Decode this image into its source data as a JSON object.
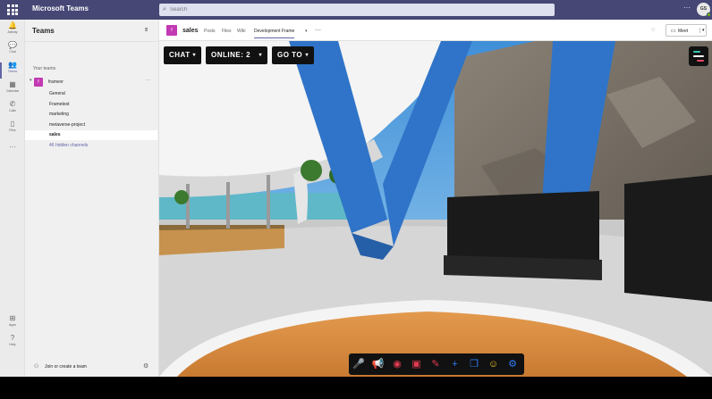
{
  "app": {
    "title": "Microsoft Teams"
  },
  "search": {
    "placeholder": "Search"
  },
  "user": {
    "initials": "GS"
  },
  "rail": [
    {
      "label": "Activity",
      "icon": "bell-icon",
      "glyph": "🔔"
    },
    {
      "label": "Chat",
      "icon": "chat-icon",
      "glyph": "💬"
    },
    {
      "label": "Teams",
      "icon": "teams-icon",
      "glyph": "👥"
    },
    {
      "label": "Calendar",
      "icon": "calendar-icon",
      "glyph": "▦"
    },
    {
      "label": "Calls",
      "icon": "phone-icon",
      "glyph": "✆"
    },
    {
      "label": "Files",
      "icon": "file-icon",
      "glyph": "▯"
    },
    {
      "label": "",
      "icon": "more-icon",
      "glyph": "···"
    },
    {
      "label": "Apps",
      "icon": "apps-icon",
      "glyph": "⊞"
    },
    {
      "label": "Help",
      "icon": "help-icon",
      "glyph": "?"
    }
  ],
  "sidebar": {
    "title": "Teams",
    "your_teams": "Your teams",
    "team": {
      "initial": "f",
      "name": "framevr"
    },
    "channels": [
      {
        "name": "General",
        "selected": false
      },
      {
        "name": "Frametest",
        "selected": false
      },
      {
        "name": "marketing",
        "selected": false
      },
      {
        "name": "metaverse-project",
        "selected": false
      },
      {
        "name": "sales",
        "selected": true
      },
      {
        "name": "46 hidden channels",
        "selected": false,
        "hidden": true
      }
    ],
    "footer": "Join or create a team"
  },
  "channel_header": {
    "initial": "f",
    "name": "sales",
    "tabs": [
      "Posts",
      "Files",
      "Wiki",
      "Development Frame"
    ],
    "active_tab": "Development Frame",
    "meet_label": "Meet"
  },
  "scene": {
    "chat_label": "CHAT",
    "online_label": "ONLINE: 2",
    "goto_label": "GO TO",
    "menu_colors": [
      "#35c6b1",
      "#ffffff",
      "#e84a6a"
    ]
  },
  "toolbar": [
    {
      "icon": "microphone-icon",
      "glyph": "🎤",
      "color": "#2f7cf6"
    },
    {
      "icon": "megaphone-icon",
      "glyph": "📢",
      "color": "#e23b4f"
    },
    {
      "icon": "camera-off-icon",
      "glyph": "◉",
      "color": "#e23b4f"
    },
    {
      "icon": "screen-share-icon",
      "glyph": "▣",
      "color": "#e23b4f"
    },
    {
      "icon": "pen-tool-icon",
      "glyph": "✎",
      "color": "#e23b4f"
    },
    {
      "icon": "plus-icon",
      "glyph": "+",
      "color": "#2f7cf6"
    },
    {
      "icon": "layers-icon",
      "glyph": "❐",
      "color": "#2f7cf6"
    },
    {
      "icon": "emoji-icon",
      "glyph": "☺",
      "color": "#f5c518"
    },
    {
      "icon": "settings-icon",
      "glyph": "⚙",
      "color": "#2f7cf6"
    }
  ]
}
